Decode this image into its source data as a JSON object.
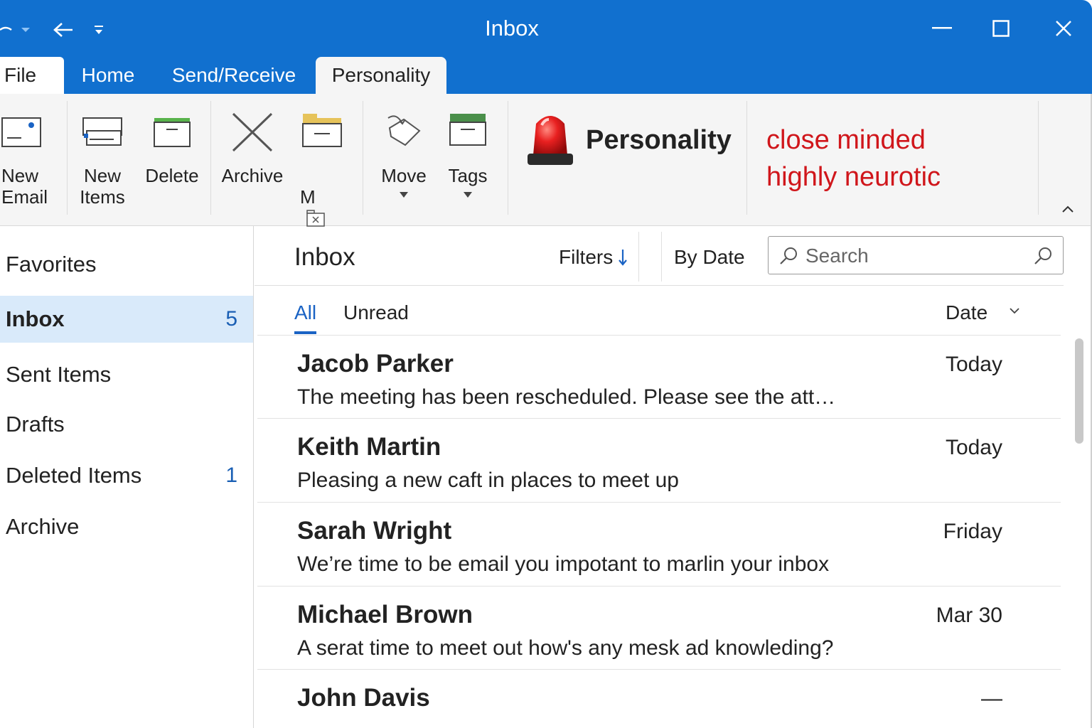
{
  "window": {
    "title": "Inbox",
    "accent": "#1170cf"
  },
  "tabs": [
    {
      "label": "File"
    },
    {
      "label": "Home"
    },
    {
      "label": "Send/Receive"
    },
    {
      "label": "Personality",
      "active": true
    }
  ],
  "ribbon": {
    "buttons": [
      {
        "label": "New\nEmail",
        "icon": "new-email-icon"
      },
      {
        "label": "New\nItems",
        "icon": "new-items-icon"
      },
      {
        "label": "Delete",
        "icon": "delete-icon"
      },
      {
        "label": "Archive",
        "icon": "archive-icon"
      },
      {
        "label": "M",
        "icon": "move-to-folder-icon"
      },
      {
        "label": "Move",
        "icon": "move-icon"
      },
      {
        "label": "Tags",
        "icon": "tags-icon"
      }
    ],
    "personality": {
      "label": "Personality",
      "icon": "siren-icon",
      "traits": [
        "close minded",
        "highly neurotic"
      ],
      "trait_color": "#d0161b"
    }
  },
  "sidebar": {
    "header": "Favorites",
    "items": [
      {
        "label": "Inbox",
        "count": "5",
        "active": true
      },
      {
        "label": "Sent Items",
        "count": ""
      },
      {
        "label": "Drafts",
        "count": ""
      },
      {
        "label": "Deleted Items",
        "count": "1"
      },
      {
        "label": "Archive",
        "count": ""
      }
    ]
  },
  "list": {
    "title": "Inbox",
    "filters_label": "Filters",
    "sort_label": "By Date",
    "search_placeholder": "Search",
    "filter_tabs": [
      "All",
      "Unread"
    ],
    "column_sort": "Date",
    "messages": [
      {
        "sender": "Jacob Parker",
        "preview": "The meeting has been rescheduled. Please see the att…",
        "date": "Today"
      },
      {
        "sender": "Keith Martin",
        "preview": "Pleasing a new caft  in places to meet up",
        "date": "Today"
      },
      {
        "sender": "Sarah Wright",
        "preview": "We’re time to be email you impotant to marlin  your inbox",
        "date": "Friday"
      },
      {
        "sender": "Michael Brown",
        "preview": "A serat time to meet out  how's any  mesk ad knowleding?",
        "date": "Mar 30"
      },
      {
        "sender": "John Davis",
        "preview": "",
        "date": "—"
      }
    ]
  }
}
